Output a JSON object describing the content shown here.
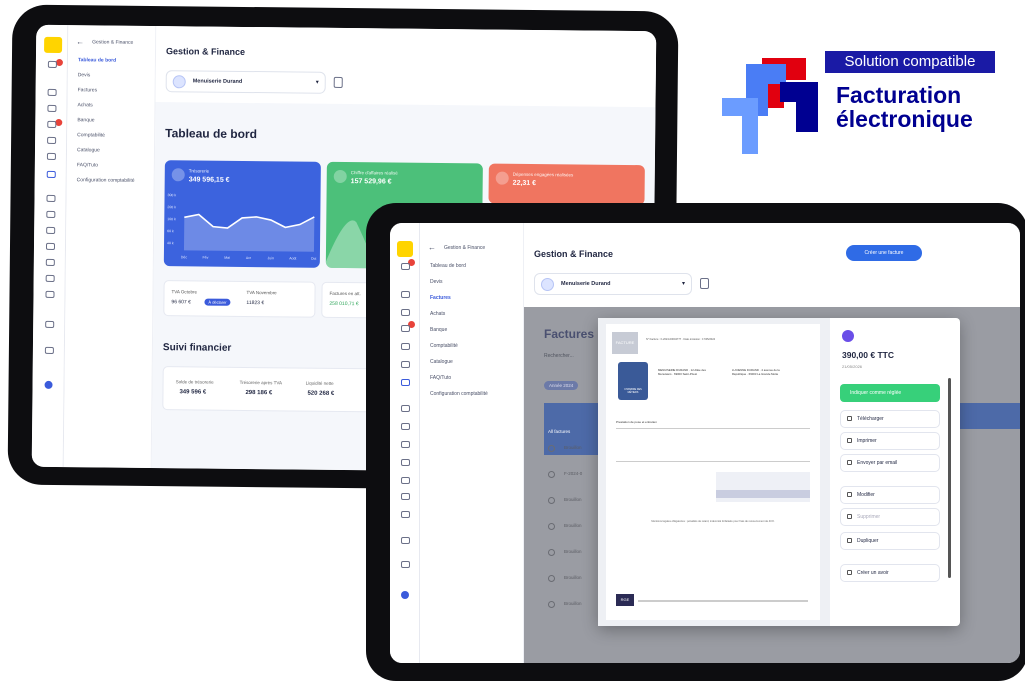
{
  "back_tablet": {
    "nav_back": "←",
    "nav_section": "Gestion & Finance",
    "nav_items": [
      "Tableau de bord",
      "Devis",
      "Factures",
      "Achats",
      "Banque",
      "Comptabilité",
      "Catalogue",
      "FAQ/Tuto",
      "Configuration comptabilité"
    ],
    "header_title": "Gestion & Finance",
    "company": "Menuiserie Durand",
    "page_title": "Tableau de bord",
    "cards": [
      {
        "label": "Trésorerie",
        "value": "349 596,15 €",
        "color": "#3c63de"
      },
      {
        "label": "Chiffre d'affaires réalisé",
        "value": "157 529,96 €",
        "color": "#4cc07a"
      },
      {
        "label": "Dépenses engagées réalisées",
        "value": "22,31 €",
        "color": "#f07560"
      }
    ],
    "chart_data": {
      "type": "area",
      "categories": [
        "Déc",
        "Fév",
        "Mai",
        "Avr",
        "Juin",
        "Août",
        "Oct"
      ],
      "values": [
        55,
        60,
        40,
        38,
        55,
        57,
        52,
        40,
        45,
        58
      ],
      "ylabels": [
        "300 k",
        "200 k",
        "100 k",
        "60 k",
        "40 k"
      ]
    },
    "mini_stats": [
      {
        "label": "TVA Octobre",
        "value": "96 607 €",
        "badge": "À déclarer"
      },
      {
        "label": "TVA Novembre",
        "value": "11823 €"
      },
      {
        "label": "Factures en att.",
        "value": "258 010,71 €"
      }
    ],
    "section_title": "Suivi financier",
    "finance": [
      {
        "label": "Solde de trésorerie",
        "value": "349 596 €"
      },
      {
        "label": "Trésorerie après TVA",
        "value": "298 186 €"
      },
      {
        "label": "Liquidité nette",
        "value": "520 268 €"
      }
    ]
  },
  "front_tablet": {
    "nav_back": "←",
    "nav_section": "Gestion & Finance",
    "nav_items": [
      "Tableau de bord",
      "Devis",
      "Factures",
      "Achats",
      "Banque",
      "Comptabilité",
      "Catalogue",
      "FAQ/Tuto",
      "Configuration comptabilité"
    ],
    "header_title": "Gestion & Finance",
    "create_button": "Créer une facture",
    "company": "Menuiserie Durand",
    "list_title": "Factures",
    "search_placeholder": "Rechercher...",
    "filter_chip": "Année 2024",
    "list_all": "All factures",
    "rows": [
      "Brouillon",
      "F-2024-0",
      "Brouillon",
      "Brouillon",
      "Brouillon",
      "Brouillon",
      "Brouillon"
    ],
    "invoice": {
      "doc_label": "FACTURE",
      "ref": "N° Facture : F-2024-00004777 · Date émission : 17/05/2024",
      "seller": "MENUISERIE DURAND · 12 Allée des Menuisiers · 69000 Saint-Priest",
      "buyer": "LUCIENNE DURAND · 4 avenue de la République · 69003 La Grande Motte",
      "table_title": "Prestation de pose et entretien",
      "footer_note": "Mentions légales obligatoires : pénalités de retard, indemnité forfaitaire pour frais de recouvrement de 40 €.",
      "seal_text": "CHAMBRE DES MÉTIERS",
      "stamp": "RGE"
    },
    "panel": {
      "amount": "390,00 € TTC",
      "due": "21/05/2026",
      "primary_action": "Indiquer comme réglée",
      "actions": [
        "Télécharger",
        "Imprimer",
        "Envoyer par email",
        "Modifier",
        "Supprimer",
        "Dupliquer",
        "Créer un avoir"
      ],
      "icons": [
        "download-icon",
        "print-icon",
        "mail-icon",
        "pen-icon",
        "trash-icon",
        "copy-icon",
        "undo-icon"
      ]
    }
  },
  "badge": {
    "top": "Solution compatible",
    "line1": "Facturation",
    "line2": "électronique",
    "colors": {
      "red": "#e1000f",
      "blue": "#000091",
      "light": "#4a7df5"
    }
  }
}
